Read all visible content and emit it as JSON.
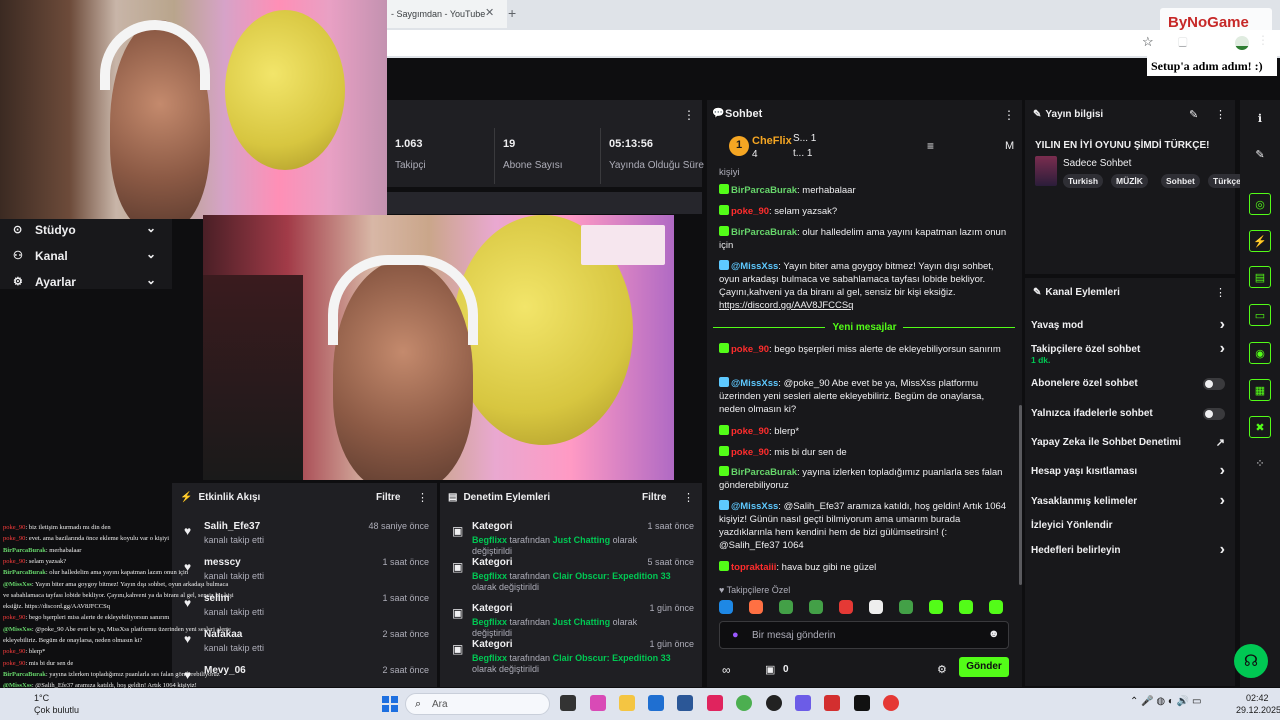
{
  "browser": {
    "tab_title": "- Saygımdan - YouTube",
    "tab_close": "✕",
    "new_tab": "+",
    "star": "☆",
    "menu": "⋮"
  },
  "watermark": {
    "logo_text": "ByNoGame"
  },
  "setup_note": "Setup'a adım adım! :)",
  "sidebar": {
    "items": [
      {
        "icon": "studio-icon",
        "glyph": "⊙",
        "label": "Stüdyo",
        "chevron": "⌄"
      },
      {
        "icon": "channel-icon",
        "glyph": "⚇",
        "label": "Kanal",
        "chevron": "⌄"
      },
      {
        "icon": "settings-icon",
        "glyph": "⚙",
        "label": "Ayarlar",
        "chevron": "⌄"
      }
    ]
  },
  "stats": {
    "kebab": "⋮",
    "items": [
      {
        "value": "1.063",
        "label": "Takipçi"
      },
      {
        "value": "19",
        "label": "Abone Sayısı"
      },
      {
        "value": "05:13:56",
        "label": "Yayında Olduğu Süre"
      }
    ]
  },
  "activity": {
    "title": "Etkinlik Akışı",
    "filter": "Filtre",
    "kebab": "⋮",
    "items": [
      {
        "name": "Salih_Efe37",
        "desc": "kanalı takip etti",
        "time": "48 saniye önce"
      },
      {
        "name": "messcy",
        "desc": "kanalı takip etti",
        "time": "1 saat önce"
      },
      {
        "name": "selim",
        "desc": "kanalı takip etti",
        "time": "1 saat önce"
      },
      {
        "name": "Nafakaa",
        "desc": "kanalı takip etti",
        "time": "2 saat önce"
      },
      {
        "name": "Mevy_06",
        "desc": "",
        "time": "2 saat önce"
      }
    ]
  },
  "moderation": {
    "title": "Denetim Eylemleri",
    "filter": "Filtre",
    "kebab": "⋮",
    "items": [
      {
        "title": "Kategori",
        "by": "Begflixx",
        "mid": "tarafından",
        "target": "Just Chatting",
        "end": "olarak değiştirildi",
        "time": "1 saat önce"
      },
      {
        "title": "Kategori",
        "by": "Begflixx",
        "mid": "tarafından",
        "target": "Clair Obscur: Expedition 33",
        "end": "olarak değiştirildi",
        "time": "5 saat önce"
      },
      {
        "title": "Kategori",
        "by": "Begflixx",
        "mid": "tarafından",
        "target": "Just Chatting",
        "end": "olarak değiştirildi",
        "time": "1 gün önce"
      },
      {
        "title": "Kategori",
        "by": "Begflixx",
        "mid": "tarafından",
        "target": "Clair Obscur: Expedition 33",
        "end": "olarak değiştirildi",
        "time": "1 gün önce"
      }
    ]
  },
  "chat": {
    "title": "Sohbet",
    "kebab": "⋮",
    "leaders": {
      "rank": "1",
      "name": "CheFlix",
      "sub": "4",
      "second": "S...  1",
      "third": "t...  1",
      "m": "M"
    },
    "top_fragment": "kişiyi",
    "messages_old": [
      {
        "user": "BirParcaBurak",
        "text": ": merhabalaar"
      },
      {
        "user": "poke_90",
        "text": ": selam yazsak?"
      },
      {
        "user": "BirParcaBurak",
        "text": ": olur halledelim ama yayını kapatman lazım onun için"
      },
      {
        "user": "@MissXss",
        "text": ": Yayın biter ama goygoy bitmez! Yayın dışı sohbet, oyun arkadaşı bulmaca ve sabahlamaca tayfası lobide bekliyor. Çayını,kahveni ya da biranı al gel, sensiz bir kişi eksiğiz.",
        "link": "https://discord.gg/AAV8JFCCSq"
      }
    ],
    "new_messages_label": "Yeni mesajlar",
    "messages_new": [
      {
        "user": "poke_90",
        "text": ": bego bşerpleri miss alerte de ekleyebiliyorsun sanırım"
      },
      {
        "user": "@MissXss",
        "text": ": @poke_90 Abe evet be ya, MissXss platformu üzerinden yeni sesleri alerte ekleyebiliriz. Begüm de onaylarsa, neden olmasın ki?"
      },
      {
        "user": "poke_90",
        "text": ": blerp*"
      },
      {
        "user": "poke_90",
        "text": ": mis bi dur sen de"
      },
      {
        "user": "BirParcaBurak",
        "text": ": yayına izlerken topladığımız puanlarla ses falan gönderebiliyoruz"
      },
      {
        "user": "@MissXss",
        "text": ": @Salih_Efe37 aramıza katıldı, hoş geldin! Artık 1064 kişiyiz! Günün nasıl geçti bilmiyorum ama umarım burada yazdıklarınla hem kendini hem de bizi gülümsetirsin! (: @Salih_Efe37 1064"
      },
      {
        "user": "topraktaiii",
        "text": ": hava buz gibi ne güzel"
      }
    ],
    "followers_only": "♥ Takipçilere Özel",
    "input_placeholder": "Bir mesaj gönderin",
    "gift_count": "0",
    "send_label": "Gönder"
  },
  "stream_info": {
    "title": "Yayın bilgisi",
    "stream_title": "YILIN EN İYİ OYUNU ŞİMDİ TÜRKÇE!",
    "category": "Sadece Sohbet",
    "tags": [
      "Turkish",
      "MÜZİK",
      "Sohbet",
      "Türkçe"
    ]
  },
  "channel_actions": {
    "title": "Kanal Eylemleri",
    "kebab": "⋮",
    "items": [
      {
        "label": "Yavaş mod",
        "kind": "chevron"
      },
      {
        "label": "Takipçilere özel sohbet",
        "sub": "1 dk.",
        "kind": "chevron"
      },
      {
        "label": "Abonelere özel sohbet",
        "kind": "toggle"
      },
      {
        "label": "Yalnızca ifadelerle sohbet",
        "kind": "toggle"
      },
      {
        "label": "Yapay Zeka ile Sohbet Denetimi",
        "kind": "external"
      },
      {
        "label": "Hesap yaşı kısıtlaması",
        "kind": "chevron"
      },
      {
        "label": "Yasaklanmış kelimeler",
        "kind": "chevron"
      },
      {
        "label": "İzleyici Yönlendir",
        "kind": "none"
      },
      {
        "label": "Hedefleri belirleyin",
        "kind": "chevron"
      }
    ]
  },
  "overlay_chat": [
    {
      "user": "poke_90",
      "red": true,
      "text": "biz iletişim kurmadı mı din den"
    },
    {
      "user": "poke_90",
      "red": true,
      "text": "evet. ama bazilarında önce ekleme koyulu var o kişiyi"
    },
    {
      "user": "BirParcaBurak",
      "red": false,
      "text": "merhabalaar"
    },
    {
      "user": "poke_90",
      "red": true,
      "text": "selam yazsak?"
    },
    {
      "user": "BirParcaBurak",
      "red": false,
      "text": "olur halledelim ama yayını kapatman lazım onun için"
    },
    {
      "user": "@MissXss",
      "red": false,
      "text": "Yayın biter ama goygoy bitmez! Yayın dışı sohbet, oyun arkadaşı bulmaca"
    },
    {
      "user": "",
      "red": false,
      "text": "ve sabahlamaca tayfası lobide bekliyor. Çayını,kahveni ya da biranı al gel, sensiz bir kişi"
    },
    {
      "user": "",
      "red": false,
      "text": "eksiğiz. https://discord.gg/AAV8JFCCSq"
    },
    {
      "user": "poke_90",
      "red": true,
      "text": "bego bşerpleri miss alerte de ekleyebiliyorsun sanırım"
    },
    {
      "user": "@MissXss",
      "red": false,
      "text": "@poke_90 Abe evet be ya, MissXss platformu üzerinden yeni sesleri alerte"
    },
    {
      "user": "",
      "red": false,
      "text": "ekleyebiliriz. Begüm de onaylarsa, neden olmasın ki?"
    },
    {
      "user": "poke_90",
      "red": true,
      "text": "blerp*"
    },
    {
      "user": "poke_90",
      "red": true,
      "text": "mis bi dur sen de"
    },
    {
      "user": "BirParcaBurak",
      "red": false,
      "text": "yayına izlerken topladığımız puanlarla ses falan gönderebiliyoruz"
    },
    {
      "user": "@MissXss",
      "red": false,
      "text": "@Salih_Efe37 aramıza katıldı, hoş geldin! Artık 1064 kişiyiz!"
    },
    {
      "user": "topraktaiii",
      "red": true,
      "text": "hava buz gibi ne güzel"
    }
  ],
  "taskbar": {
    "weather_temp": "1°C",
    "weather_desc": "Çok bulutlu",
    "search_placeholder": "Ara",
    "time": "02:42",
    "date": "29.12.2025"
  },
  "colors": {
    "accent": "#53fc18",
    "chat_bg": "#18181b",
    "panel_bg": "#1f1f23"
  }
}
